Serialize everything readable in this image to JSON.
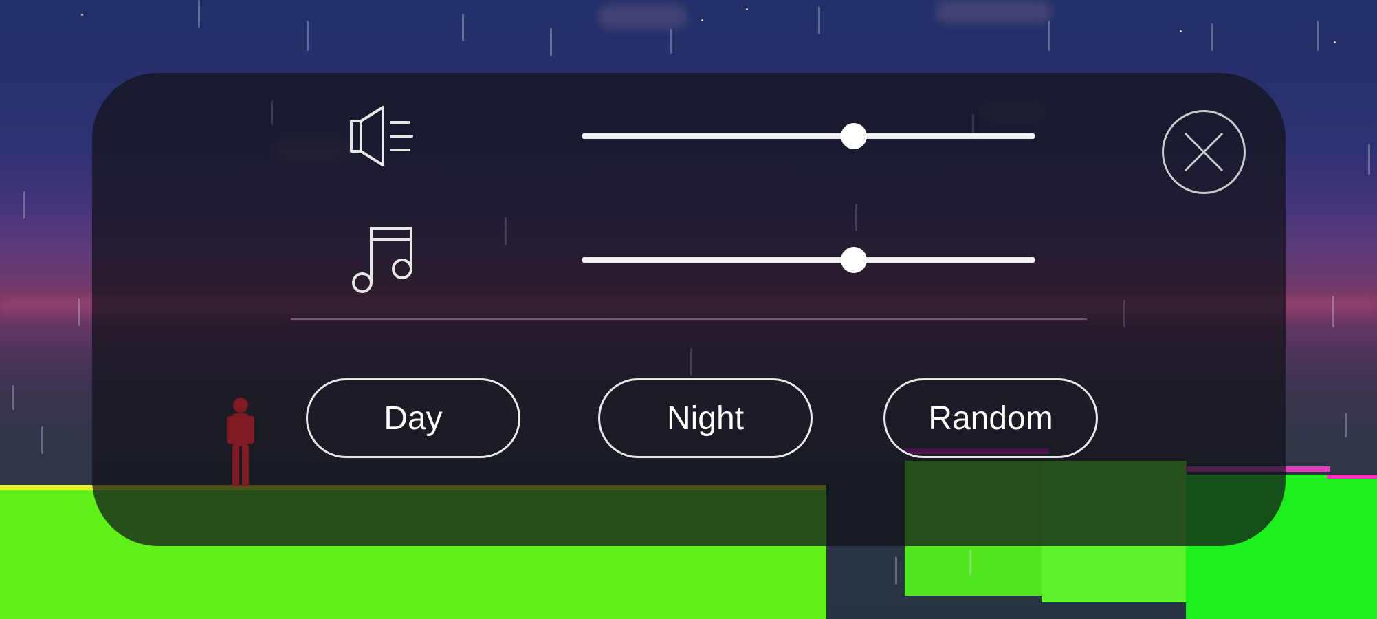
{
  "settings": {
    "sound_icon": "speaker-icon",
    "music_icon": "music-note-icon",
    "sound_volume": 0.6,
    "music_volume": 0.6,
    "close_icon": "close-icon"
  },
  "theme_buttons": {
    "day_label": "Day",
    "night_label": "Night",
    "random_label": "Random"
  },
  "colors": {
    "panel": "#121218",
    "accent": "#ffffff",
    "ground_green": "#5ff01a",
    "glitch_magenta": "#d01fd0",
    "sky_top": "#23306a",
    "character": "#8a1a22"
  }
}
